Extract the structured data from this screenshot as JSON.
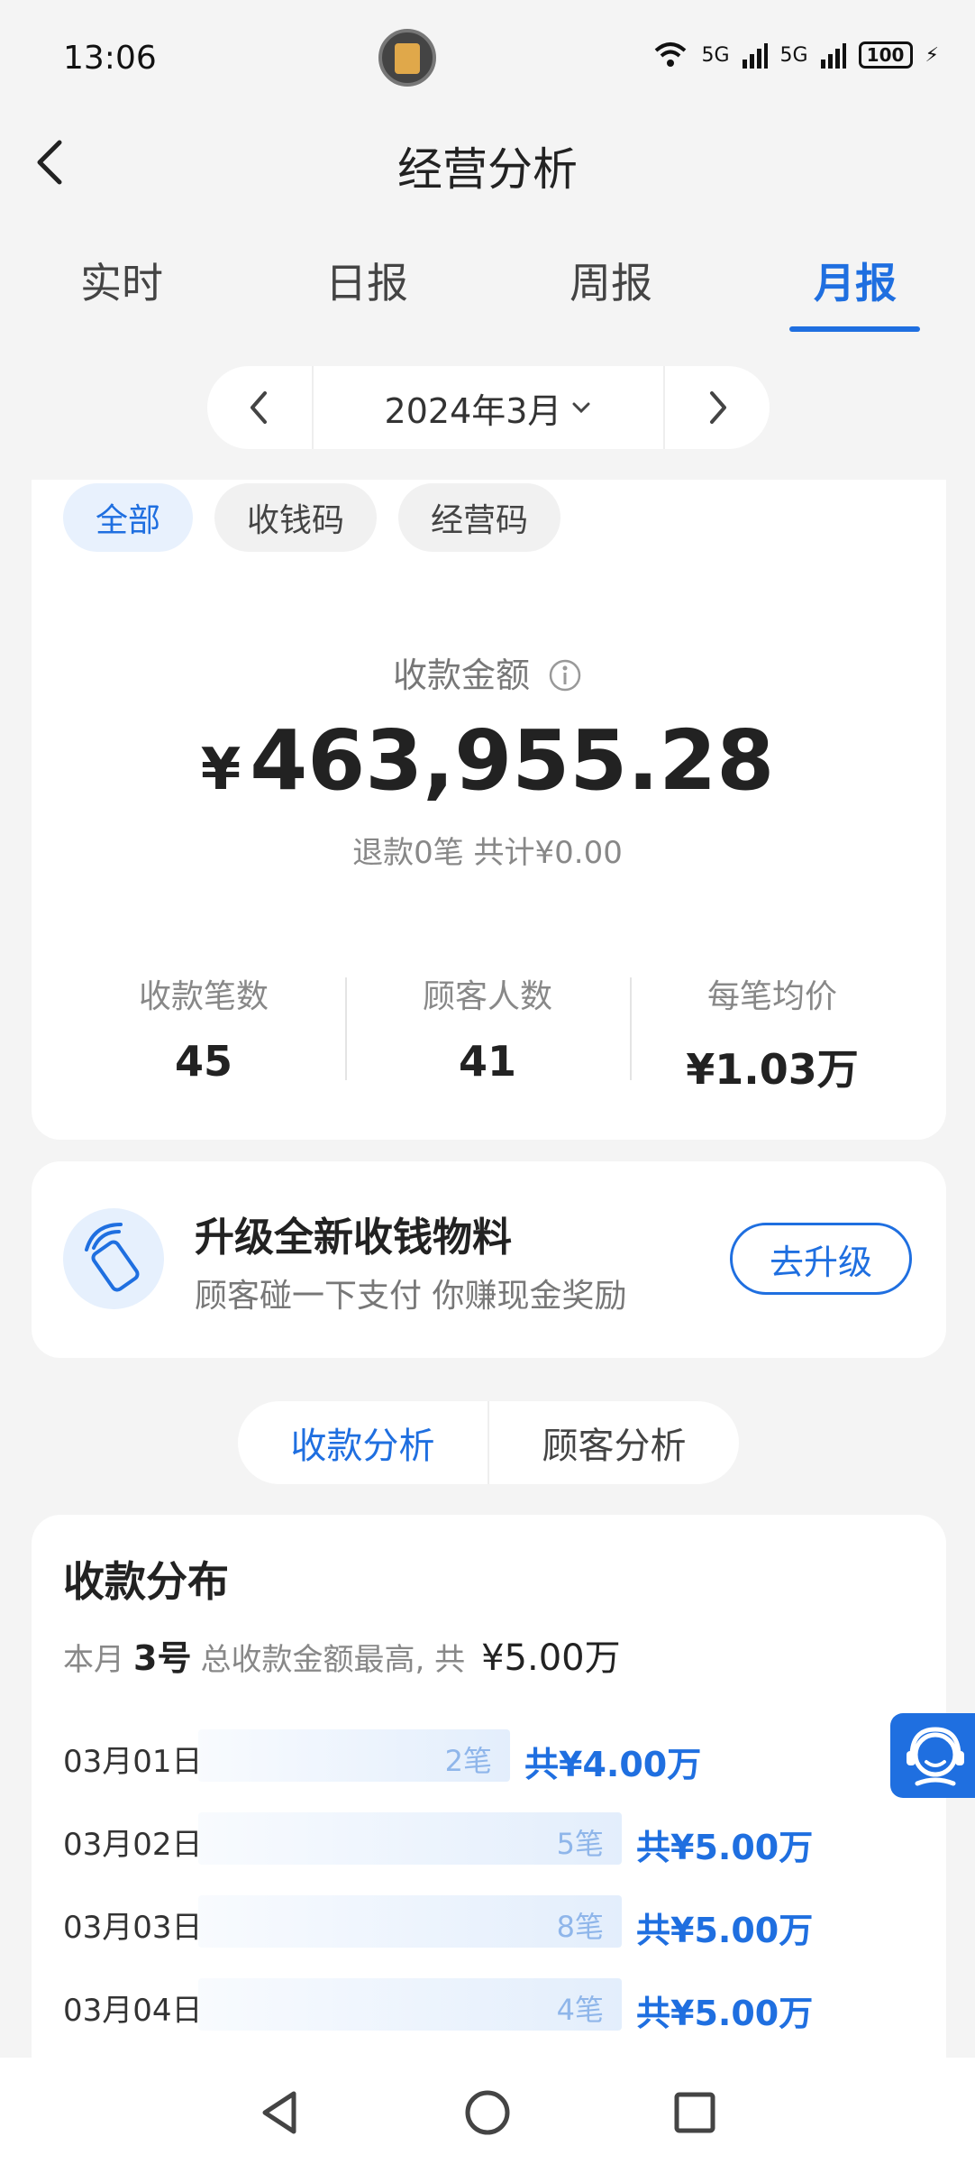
{
  "status_bar": {
    "time": "13:06",
    "network1": "5G",
    "network2": "5G",
    "battery": "100"
  },
  "header": {
    "title": "经营分析"
  },
  "tabs": [
    {
      "label": "实时",
      "active": false
    },
    {
      "label": "日报",
      "active": false
    },
    {
      "label": "周报",
      "active": false
    },
    {
      "label": "月报",
      "active": true
    }
  ],
  "month_selector": {
    "value": "2024年3月"
  },
  "filter_chips": [
    {
      "label": "全部",
      "active": true
    },
    {
      "label": "收钱码",
      "active": false
    },
    {
      "label": "经营码",
      "active": false
    }
  ],
  "summary": {
    "label": "收款金额",
    "currency": "¥",
    "amount": "463,955.28",
    "refund": "退款0笔 共计¥0.00",
    "stats": [
      {
        "label": "收款笔数",
        "value": "45"
      },
      {
        "label": "顾客人数",
        "value": "41"
      },
      {
        "label": "每笔均价",
        "value": "¥1.03万"
      }
    ]
  },
  "promo": {
    "title": "升级全新收钱物料",
    "subtitle": "顾客碰一下支付 你赚现金奖励",
    "button": "去升级"
  },
  "segment": [
    {
      "label": "收款分析",
      "active": true
    },
    {
      "label": "顾客分析",
      "active": false
    }
  ],
  "distribution": {
    "title": "收款分布",
    "sub_prefix": "本月",
    "sub_day": "3号",
    "sub_middle": "总收款金额最高, 共",
    "sub_amount": "¥5.00万",
    "rows": [
      {
        "date": "03月01日",
        "count": "2笔",
        "total": "共¥4.00万",
        "fraction": 0.8
      },
      {
        "date": "03月02日",
        "count": "5笔",
        "total": "共¥5.00万",
        "fraction": 1.0
      },
      {
        "date": "03月03日",
        "count": "8笔",
        "total": "共¥5.00万",
        "fraction": 1.0
      },
      {
        "date": "03月04日",
        "count": "4笔",
        "total": "共¥5.00万",
        "fraction": 1.0
      }
    ]
  },
  "colors": {
    "accent": "#1f6fe0",
    "background": "#f4f4f4"
  }
}
